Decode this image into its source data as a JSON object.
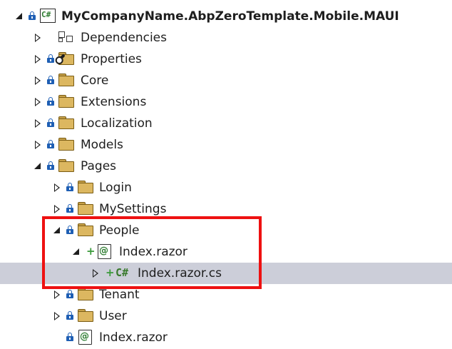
{
  "tree": {
    "project": {
      "label": "MyCompanyName.AbpZeroTemplate.Mobile.MAUI",
      "icon": "csharp-project-icon"
    },
    "dependencies": {
      "label": "Dependencies",
      "icon": "dependencies-icon"
    },
    "properties": {
      "label": "Properties",
      "icon": "properties-folder-icon"
    },
    "core": {
      "label": "Core"
    },
    "extensions": {
      "label": "Extensions"
    },
    "localization": {
      "label": "Localization"
    },
    "models": {
      "label": "Models"
    },
    "pages": {
      "label": "Pages"
    },
    "login": {
      "label": "Login"
    },
    "mysettings": {
      "label": "MySettings"
    },
    "people": {
      "label": "People"
    },
    "index_razor": {
      "label": "Index.razor",
      "icon": "razor-file-icon"
    },
    "index_razor_cs": {
      "label": "Index.razor.cs",
      "icon": "csharp-file-icon"
    },
    "tenant": {
      "label": "Tenant"
    },
    "user": {
      "label": "User"
    },
    "pages_index_razor": {
      "label": "Index.razor",
      "icon": "razor-file-icon"
    }
  },
  "icons": {
    "project_glyph": "C#",
    "cs_glyph": "C#",
    "razor_glyph": "@",
    "added_glyph": "+"
  },
  "colors": {
    "selection": "#ccced9",
    "highlight_box": "#ee1111",
    "folder": "#dcb760",
    "lock": "#1f5fb4",
    "added": "#3a9a3a"
  }
}
